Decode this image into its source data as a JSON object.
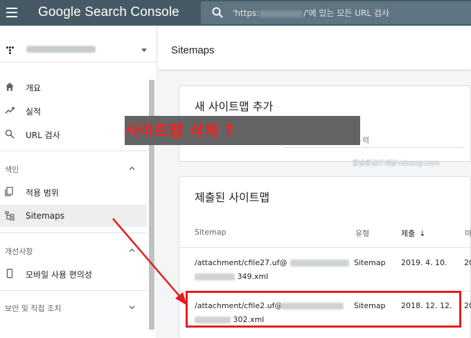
{
  "app": {
    "brand": "Google Search Console"
  },
  "search": {
    "prefix": "'https:",
    "suffix": "/'에 있는 모든 URL 검사"
  },
  "property": {
    "url": "https://rdsong.com/"
  },
  "sidebar": {
    "items_top": [
      {
        "label": "개요",
        "icon": "home-icon"
      },
      {
        "label": "실적",
        "icon": "trending-up-icon"
      },
      {
        "label": "URL 검사",
        "icon": "search-icon"
      }
    ],
    "section_index": "색인",
    "items_index": [
      {
        "label": "적용 범위",
        "icon": "coverage-icon"
      },
      {
        "label": "Sitemaps",
        "icon": "sitemap-icon"
      }
    ],
    "section_enhancements": "개선사항",
    "items_enhancements": [
      {
        "label": "모바일 사용 편의성",
        "icon": "phone-icon"
      }
    ],
    "section_security": "보안 및 직접 조치"
  },
  "page": {
    "title": "Sitemaps"
  },
  "add_card": {
    "title": "새 사이트맵 추가",
    "hint": "력"
  },
  "submitted": {
    "title": "제출된 사이트맵",
    "columns": {
      "sitemap": "Sitemap",
      "type": "유형",
      "submitted": "제출",
      "sort_arrow": "↓",
      "next": "마"
    },
    "rows": [
      {
        "path_start": "/attachment/cfile27.uf@",
        "path_end": "349.xml",
        "type": "Sitemap",
        "date": "2019. 4. 10.",
        "extra": "20"
      },
      {
        "path_start": "/attachment/cfile2.uf@",
        "path_end": "302.xml",
        "type": "Sitemap",
        "date": "2018. 12. 12.",
        "extra": "20"
      }
    ]
  },
  "annotation": {
    "callout": "사이트맵 삭제 ?",
    "watermark": "앞송맏송IT세상-rdsong.com",
    "color": "#e51b1b"
  }
}
